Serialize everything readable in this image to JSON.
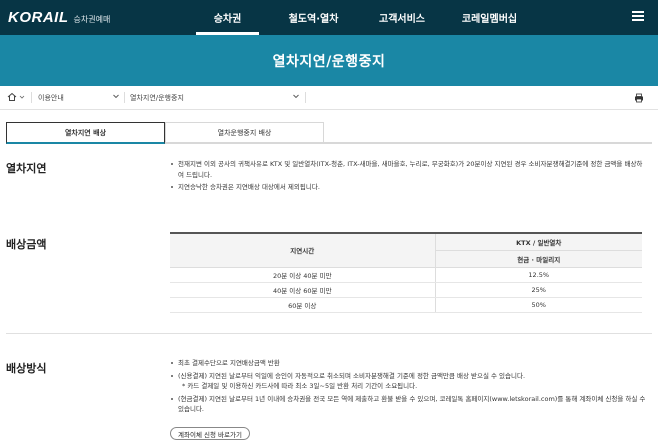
{
  "header": {
    "logo": "KORAIL",
    "logo_sub": "승차권예매",
    "menu": [
      {
        "label": "승차권",
        "active": true
      },
      {
        "label": "철도역·열차",
        "active": false
      },
      {
        "label": "고객서비스",
        "active": false
      },
      {
        "label": "코레일멤버십",
        "active": false
      }
    ]
  },
  "banner": {
    "title": "열차지연/운행중지"
  },
  "breadcrumb": {
    "level1": "이용안내",
    "level2": "열차지연/운행중지"
  },
  "tabs": [
    {
      "label": "열차지연 배상",
      "active": true
    },
    {
      "label": "열차운행중지 배상",
      "active": false
    }
  ],
  "sections": {
    "delay": {
      "title": "열차지연",
      "bullets": [
        "천재지변 이외 공사의 귀책사유로 KTX 및 일반열차(ITX-청춘, ITX-새마을, 새마을호, 누리로, 무궁화호)가 20분이상 지연된 경우 소비자분쟁해결기준에 정한 금액을 배상하여 드립니다.",
        "지연승낙한 승차권은 지연배상 대상에서 제외됩니다."
      ]
    },
    "compensation": {
      "title": "배상금액",
      "table": {
        "header_col1": "지연시간",
        "header_col2": "KTX / 일반열차",
        "header_sub": "현금 · 마일리지",
        "rows": [
          {
            "time": "20분 이상 40분 미만",
            "rate": "12.5%"
          },
          {
            "time": "40분 이상 60분 미만",
            "rate": "25%"
          },
          {
            "time": "60분 이상",
            "rate": "50%"
          }
        ]
      }
    },
    "method": {
      "title": "배상방식",
      "bullets": [
        "최초 결제수단으로 지연배상금액 반환",
        "(신용결제) 지연된 날로부터 익일에 승인이 자동적으로 취소되며 소비자분쟁해결 기준에 정한 금액만큼 배상 받으실 수 있습니다."
      ],
      "sub_note": "* 카드 결제일 및 이용하신 카드사에 따라 최소 3일~5일 반환 처리 기간이 소요됩니다.",
      "bullets2": [
        "(현금결제) 지연된 날로부터 1년 이내에 승차권을 전국 모든 역에 제출하고 환불 받을 수 있으며, 코레일톡 홈페이지(www.letskorail.com)를 통해 계좌이체 신청을 하실 수 있습니다."
      ],
      "link_label": "계좌이체 신청 바로가기"
    }
  },
  "colors": {
    "header_bg": "#073545",
    "banner_bg": "#1a87a5"
  }
}
